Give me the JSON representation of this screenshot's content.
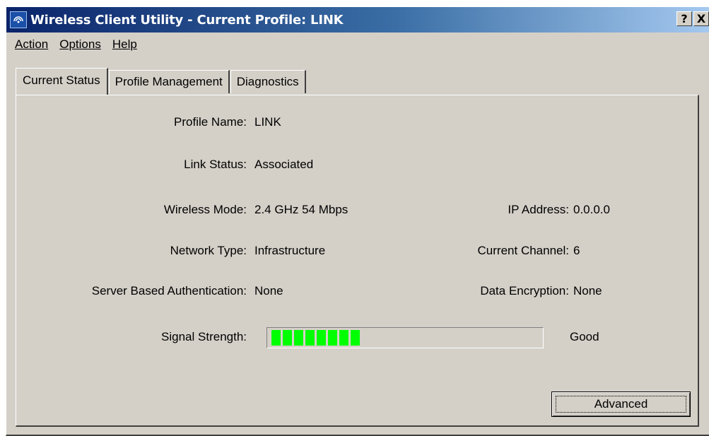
{
  "window": {
    "title": "Wireless Client Utility - Current Profile: LINK",
    "help_button": "?",
    "close_button": "X"
  },
  "menu": [
    {
      "label": "Action"
    },
    {
      "label": "Options"
    },
    {
      "label": "Help"
    }
  ],
  "tabs": [
    {
      "label": "Current Status",
      "active": true
    },
    {
      "label": "Profile Management",
      "active": false
    },
    {
      "label": "Diagnostics",
      "active": false
    }
  ],
  "status": {
    "profile_name_label": "Profile Name:",
    "profile_name": "LINK",
    "link_status_label": "Link Status:",
    "link_status": "Associated",
    "wireless_mode_label": "Wireless Mode:",
    "wireless_mode": "2.4 GHz 54 Mbps",
    "ip_address_label": "IP Address:",
    "ip_address": "0.0.0.0",
    "network_type_label": "Network Type:",
    "network_type": "Infrastructure",
    "current_channel_label": "Current Channel:",
    "current_channel": "6",
    "server_auth_label": "Server Based Authentication:",
    "server_auth": "None",
    "data_encryption_label": "Data Encryption:",
    "data_encryption": "None",
    "signal_strength_label": "Signal Strength:",
    "signal_strength_segments": 8,
    "signal_strength_quality": "Good"
  },
  "buttons": {
    "advanced": "Advanced"
  },
  "colors": {
    "title_start": "#0a246a",
    "title_end": "#a6caf0",
    "signal": "#00ff00",
    "face": "#d4d0c8"
  }
}
